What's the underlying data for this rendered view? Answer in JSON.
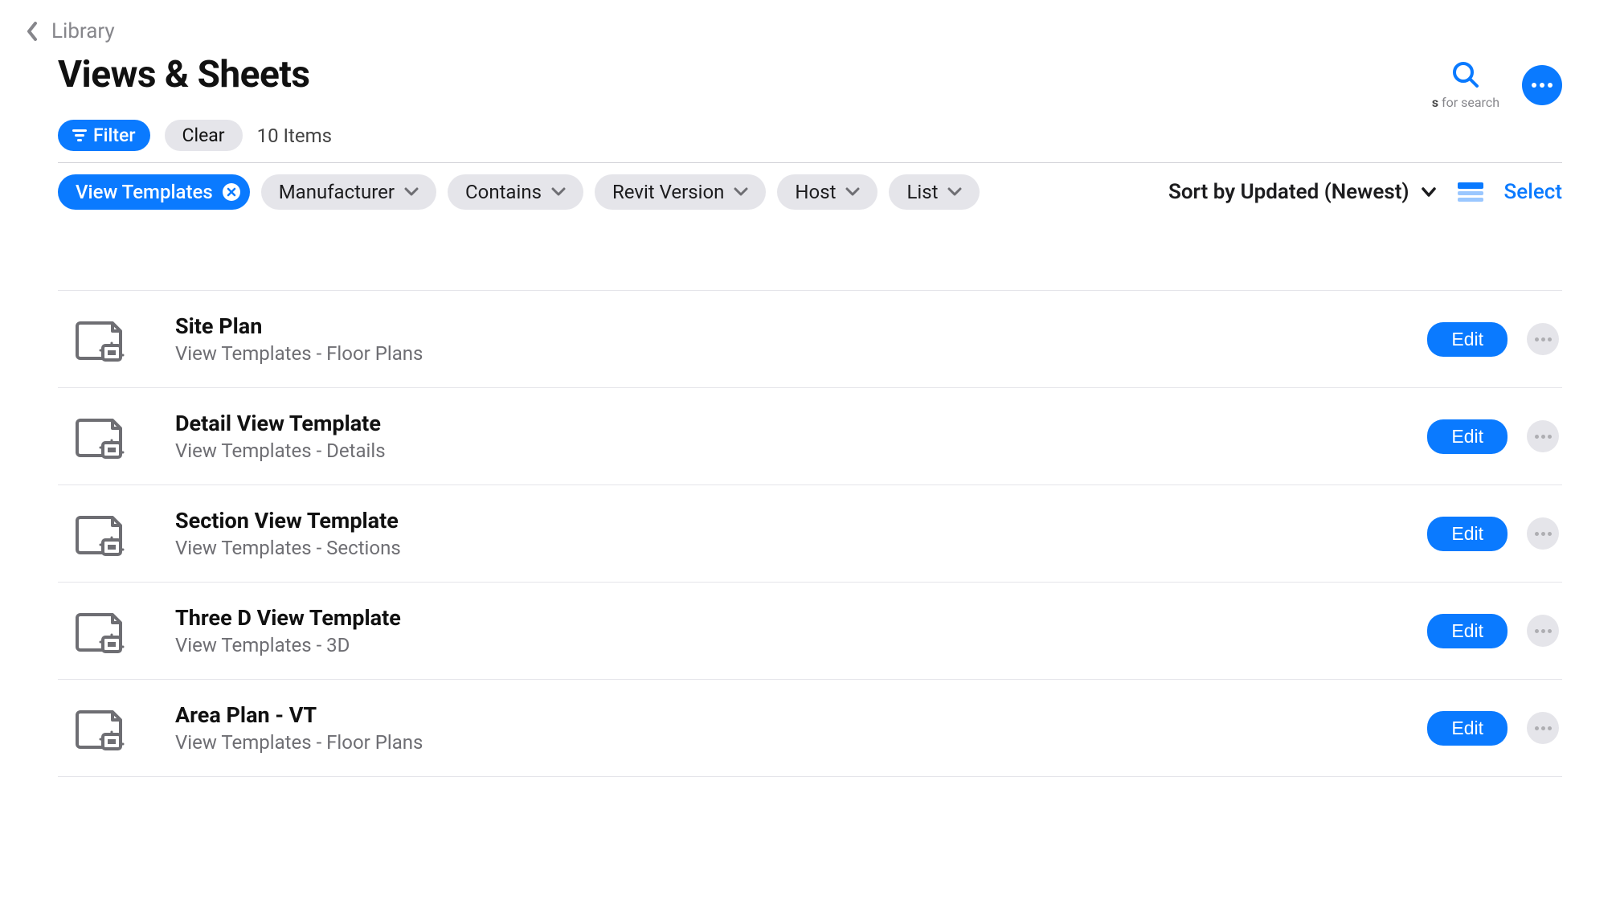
{
  "breadcrumb": {
    "label": "Library"
  },
  "page": {
    "title": "Views & Sheets",
    "item_count": "10 Items"
  },
  "actions": {
    "filter_label": "Filter",
    "clear_label": "Clear",
    "search_hint_key": "s",
    "search_hint_text": " for search",
    "sort_label": "Sort by Updated (Newest)",
    "select_label": "Select",
    "edit_label": "Edit"
  },
  "chips": {
    "active": "View Templates",
    "manufacturer": "Manufacturer",
    "contains": "Contains",
    "revit": "Revit Version",
    "host": "Host",
    "list": "List"
  },
  "items": [
    {
      "title": "Site Plan",
      "subtitle": "View Templates - Floor Plans"
    },
    {
      "title": "Detail View Template",
      "subtitle": "View Templates - Details"
    },
    {
      "title": "Section View Template",
      "subtitle": "View Templates - Sections"
    },
    {
      "title": "Three D View Template",
      "subtitle": "View Templates - 3D"
    },
    {
      "title": "Area Plan - VT",
      "subtitle": "View Templates - Floor Plans"
    }
  ]
}
